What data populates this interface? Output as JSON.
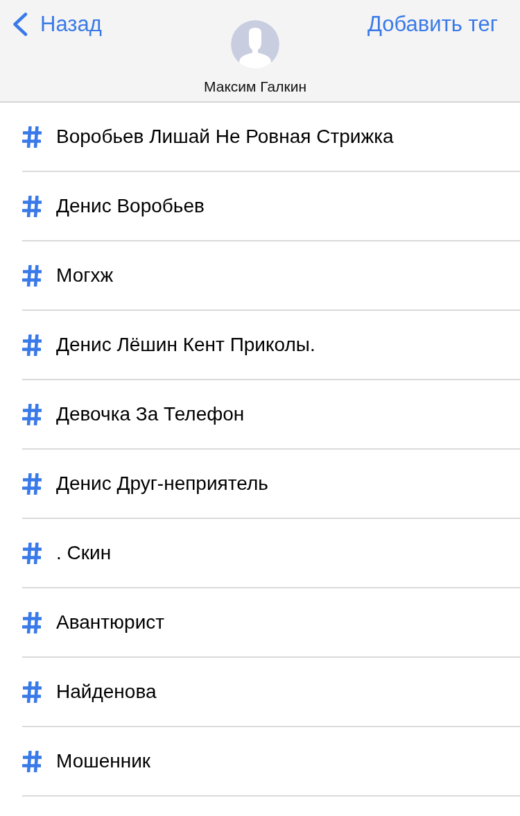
{
  "header": {
    "back_label": "Назад",
    "action_label": "Добавить тег",
    "contact_name": "Максим Галкин"
  },
  "tags": [
    {
      "label": "Воробьев Лишай Не Ровная Стрижка"
    },
    {
      "label": "Денис Воробьев"
    },
    {
      "label": "Могхж"
    },
    {
      "label": "Денис Лёшин Кент Приколы."
    },
    {
      "label": "Девочка За Телефон"
    },
    {
      "label": "Денис Друг-неприятель"
    },
    {
      "label": ". Скин"
    },
    {
      "label": "Авантюрист"
    },
    {
      "label": "Найденова"
    },
    {
      "label": "Мошенник"
    }
  ]
}
